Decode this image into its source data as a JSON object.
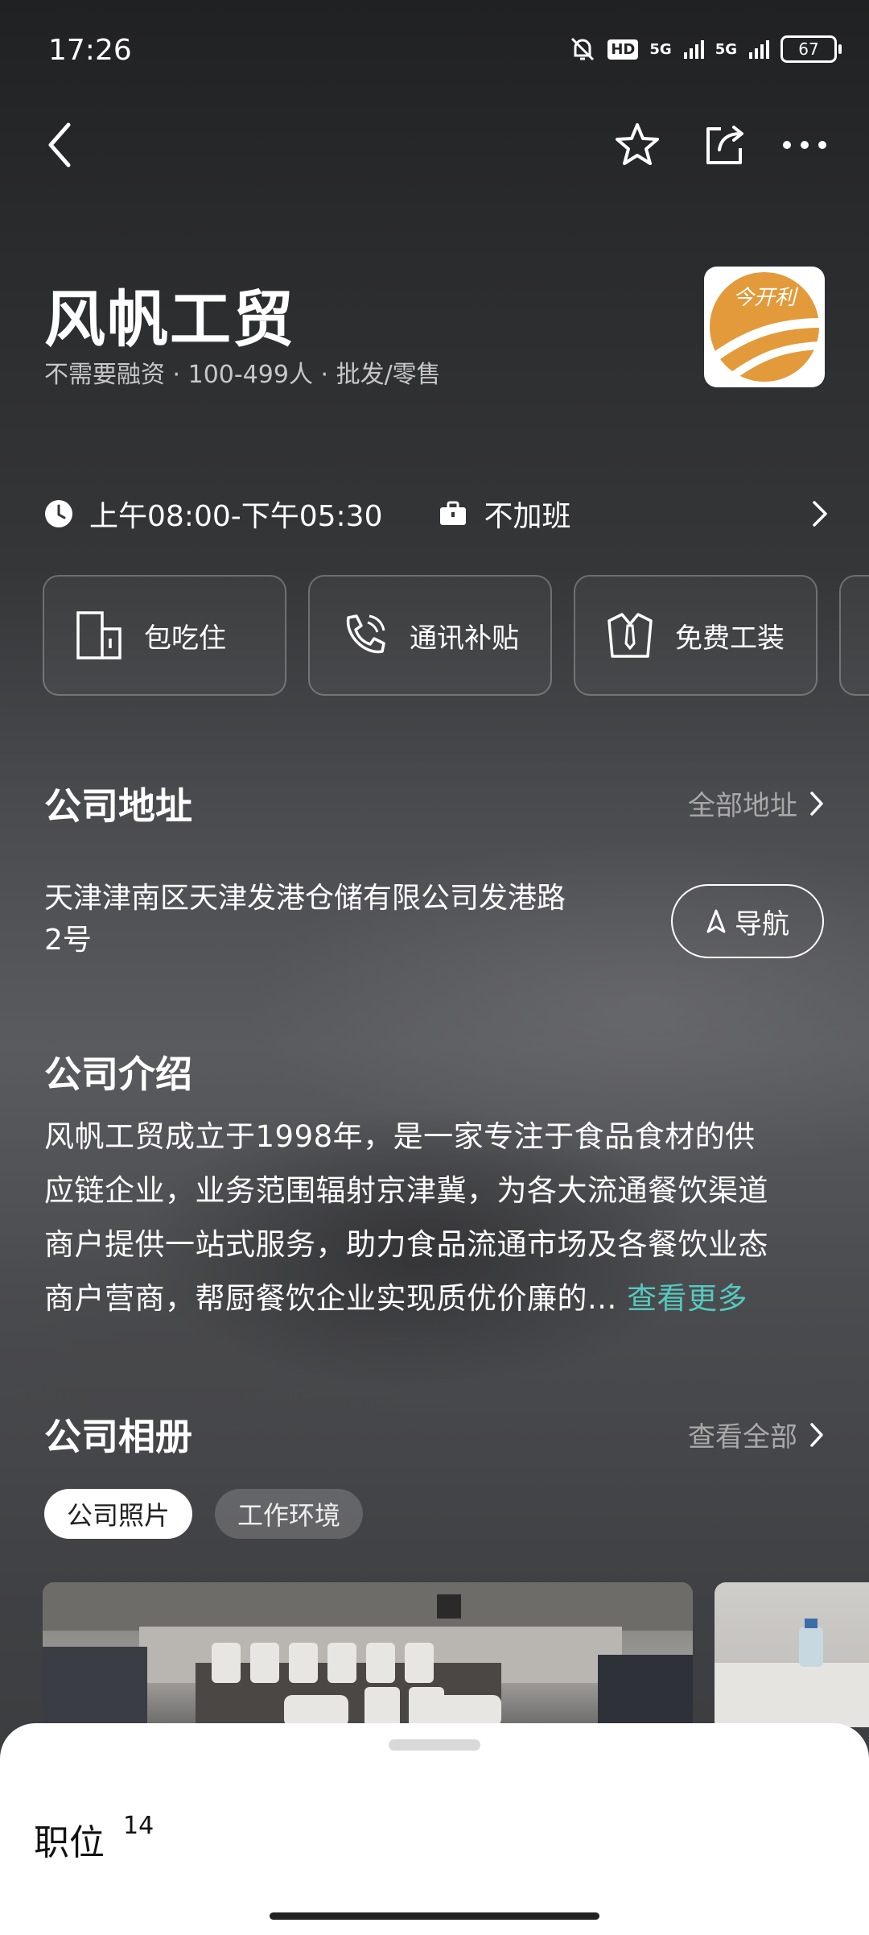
{
  "status_bar": {
    "time": "17:26",
    "hd": "HD",
    "net1": "5G",
    "net2": "5G",
    "battery": "67"
  },
  "company": {
    "name": "风帆工贸",
    "subtitle": "不需要融资 · 100-499人 · 批发/零售",
    "logo_text": "今开利"
  },
  "work_info": {
    "hours": "上午08:00-下午05:30",
    "overtime": "不加班"
  },
  "benefits": [
    {
      "label": "包吃住",
      "icon": "building-icon"
    },
    {
      "label": "通讯补贴",
      "icon": "phone-icon"
    },
    {
      "label": "免费工装",
      "icon": "shirt-icon"
    }
  ],
  "address_section": {
    "title": "公司地址",
    "link": "全部地址",
    "address_line1": "天津津南区天津发港仓储有限公司发港路",
    "address_line2": "2号",
    "nav_label": "导航"
  },
  "intro_section": {
    "title": "公司介绍",
    "lines": [
      "风帆工贸成立于1998年，是一家专注于食品食材的供",
      "应链企业，业务范围辐射京津冀，为各大流通餐饮渠道",
      "商户提供一站式服务，助力食品流通市场及各餐饮业态",
      "商户营商，帮厨餐饮企业实现质优价廉的..."
    ],
    "more": "查看更多"
  },
  "album_section": {
    "title": "公司相册",
    "link": "查看全部",
    "tabs": [
      "公司照片",
      "工作环境"
    ],
    "active_tab": 0
  },
  "bottom_sheet": {
    "title": "职位",
    "count": "14"
  },
  "colors": {
    "accent": "#57c8bf",
    "logo_orange": "#e39a3a"
  }
}
